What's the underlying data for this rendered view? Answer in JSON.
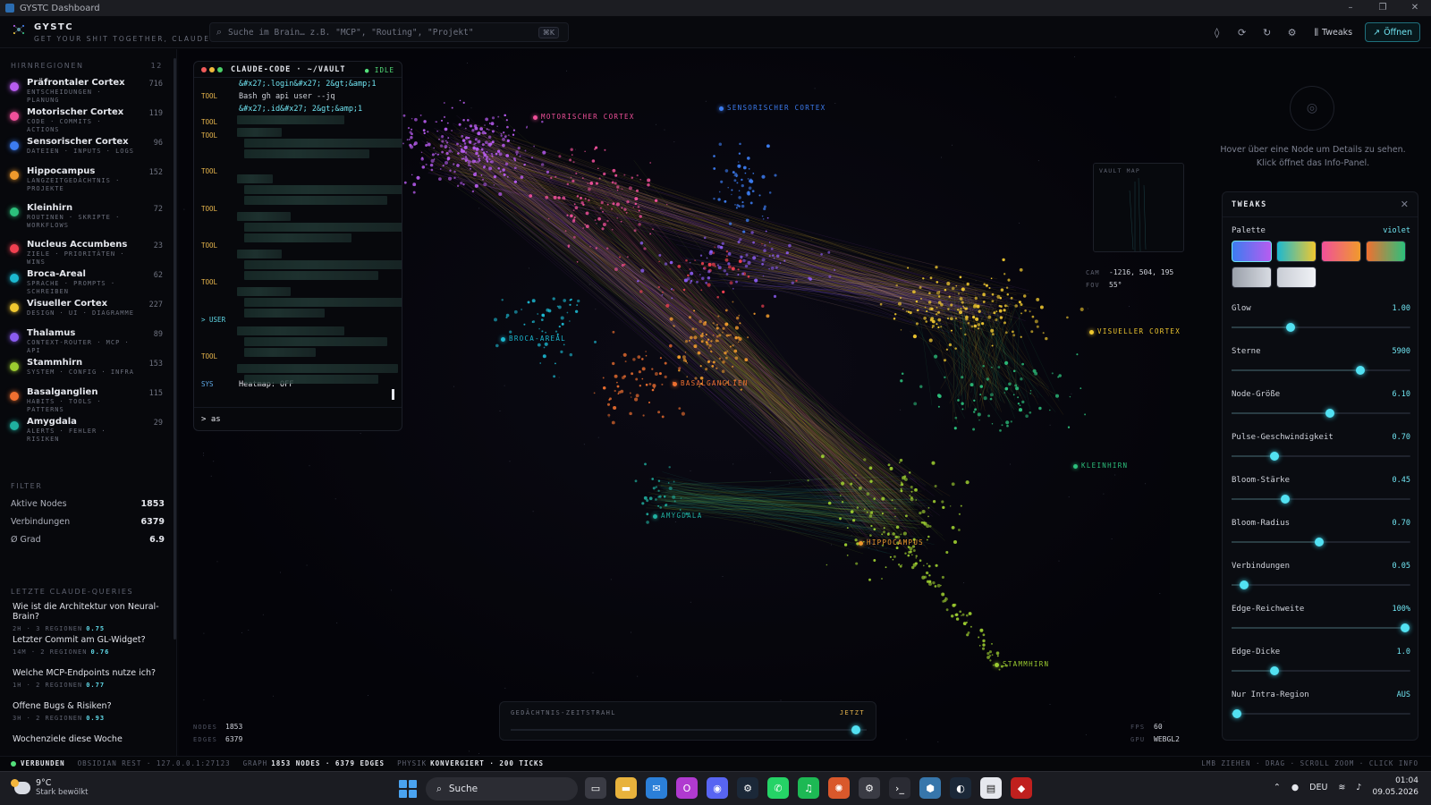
{
  "window": {
    "title": "GYSTC Dashboard",
    "controls": [
      "–",
      "❐",
      "✕"
    ]
  },
  "header": {
    "brand": "GYSTC",
    "tagline": "GET YOUR SHIT TOGETHER, CLAUDE",
    "search_placeholder": "Suche im Brain… z.B. \"MCP\", \"Routing\", \"Projekt\"",
    "search_kbd": "⌘K",
    "tweaks_label": "Tweaks",
    "open_label": "Öffnen"
  },
  "sidebar": {
    "regions_title": "HIRNREGIONEN",
    "regions_count": "12",
    "regions": [
      {
        "name": "Präfrontaler Cortex",
        "sub": "ENTSCHEIDUNGEN · PLANUNG",
        "count": "716",
        "color": "#b85cf0"
      },
      {
        "name": "Motorischer Cortex",
        "sub": "CODE · COMMITS · ACTIONS",
        "count": "119",
        "color": "#f0509a"
      },
      {
        "name": "Sensorischer Cortex",
        "sub": "DATEIEN · INPUTS · LOGS",
        "count": "96",
        "color": "#3c7cf0"
      },
      {
        "name": "Hippocampus",
        "sub": "LANGZEITGEDÄCHTNIS · PROJEKTE",
        "count": "152",
        "color": "#f09a2c"
      },
      {
        "name": "Kleinhirn",
        "sub": "ROUTINEN · SKRIPTE · WORKFLOWS",
        "count": "72",
        "color": "#2cc07c"
      },
      {
        "name": "Nucleus Accumbens",
        "sub": "ZIELE · PRIORITÄTEN · WINS",
        "count": "23",
        "color": "#f04050"
      },
      {
        "name": "Broca-Areal",
        "sub": "SPRACHE · PROMPTS · SCHREIBEN",
        "count": "62",
        "color": "#1cb8d0"
      },
      {
        "name": "Visueller Cortex",
        "sub": "DESIGN · UI · DIAGRAMME",
        "count": "227",
        "color": "#f0c830"
      },
      {
        "name": "Thalamus",
        "sub": "CONTEXT-ROUTER · MCP · API",
        "count": "89",
        "color": "#8a5cf0"
      },
      {
        "name": "Stammhirn",
        "sub": "SYSTEM · CONFIG · INFRA",
        "count": "153",
        "color": "#9ccc30"
      },
      {
        "name": "Basalganglien",
        "sub": "HABITS · TOOLS · PATTERNS",
        "count": "115",
        "color": "#f07030"
      },
      {
        "name": "Amygdala",
        "sub": "ALERTS · FEHLER · RISIKEN",
        "count": "29",
        "color": "#20b0a0"
      }
    ],
    "filter_title": "FILTER",
    "filters": [
      {
        "label": "Aktive Nodes",
        "value": "1853"
      },
      {
        "label": "Verbindungen",
        "value": "6379"
      },
      {
        "label": "Ø Grad",
        "value": "6.9"
      }
    ],
    "queries_title": "LETZTE CLAUDE-QUERIES",
    "queries": [
      {
        "text": "Wie ist die Architektur von Neural-Brain?",
        "meta": "2H · 3 REGIONEN",
        "score": "0.75"
      },
      {
        "text": "Letzter Commit am GL-Widget?",
        "meta": "14M · 2 REGIONEN",
        "score": "0.76"
      },
      {
        "text": "Welche MCP-Endpoints nutze ich?",
        "meta": "1H · 2 REGIONEN",
        "score": "0.77"
      },
      {
        "text": "Offene Bugs & Risiken?",
        "meta": "3H · 2 REGIONEN",
        "score": "0.93"
      },
      {
        "text": "Wochenziele diese Woche",
        "meta": "",
        "score": ""
      }
    ]
  },
  "terminal": {
    "title": "CLAUDE-CODE · ~/VAULT",
    "status": "● IDLE",
    "lines": [
      {
        "tag": "",
        "text": "&#x27;.login&#x27; 2&gt;&amp;1"
      },
      {
        "tag": "TOOL",
        "text": "Bash gh api user --jq"
      },
      {
        "tag": "",
        "text": "&#x27;.id&#x27; 2&gt;&amp;1"
      },
      {
        "tag": "TOOL",
        "text": ""
      },
      {
        "tag": "TOOL",
        "text": ""
      },
      {
        "tag": "TOOL",
        "text": ""
      },
      {
        "tag": "TOOL",
        "text": ""
      },
      {
        "tag": "TOOL",
        "text": ""
      },
      {
        "tag": "TOOL",
        "text": ""
      },
      {
        "tag": "> USER",
        "text": ""
      },
      {
        "tag": "TOOL",
        "text": ""
      },
      {
        "tag": "SYS",
        "text": "Heatmap: OFF"
      }
    ],
    "input": "> as"
  },
  "graph": {
    "labels": [
      {
        "text": "MOTORISCHER CORTEX",
        "color": "#f0509a"
      },
      {
        "text": "SENSORISCHER CORTEX",
        "color": "#3c7cf0"
      },
      {
        "text": "BROCA-AREAL",
        "color": "#1cb8d0"
      },
      {
        "text": "VISUELLER CORTEX",
        "color": "#f0c830"
      },
      {
        "text": "KLEINHIRN",
        "color": "#2cc07c"
      },
      {
        "text": "BASALGANGLIEN",
        "color": "#f07030"
      },
      {
        "text": "AMYGDALA",
        "color": "#20b0a0"
      },
      {
        "text": "HIPPOCAMPUS",
        "color": "#f09a2c"
      },
      {
        "text": "STAMMHIRN",
        "color": "#9ccc30"
      }
    ]
  },
  "vault_map": {
    "label": "VAULT MAP"
  },
  "camera": {
    "cam_label": "CAM",
    "cam_value": "-1216, 504, 195",
    "fov_label": "FOV",
    "fov_value": "55°"
  },
  "hint": {
    "line1": "Hover über eine Node um Details zu sehen.",
    "line2": "Klick öffnet das Info-Panel."
  },
  "tweaks": {
    "title": "TWEAKS",
    "palette_label": "Palette",
    "palette_value": "violet",
    "swatches": [
      [
        "#3c7cf0",
        "#b85cf0"
      ],
      [
        "#1cb8d0",
        "#f0c830"
      ],
      [
        "#f0509a",
        "#f09a2c"
      ],
      [
        "#f07030",
        "#2cc07c"
      ],
      [
        "#9aa0aa",
        "#d8dbe2"
      ],
      [
        "#c8ccd4",
        "#f0f2f6"
      ]
    ],
    "sliders": [
      {
        "name": "Glow",
        "value": "1.00",
        "pos": 0.33
      },
      {
        "name": "Sterne",
        "value": "5900",
        "pos": 0.72
      },
      {
        "name": "Node-Größe",
        "value": "6.10",
        "pos": 0.55
      },
      {
        "name": "Pulse-Geschwindigkeit",
        "value": "0.70",
        "pos": 0.24
      },
      {
        "name": "Bloom-Stärke",
        "value": "0.45",
        "pos": 0.3
      },
      {
        "name": "Bloom-Radius",
        "value": "0.70",
        "pos": 0.49
      },
      {
        "name": "Verbindungen",
        "value": "0.05",
        "pos": 0.07
      },
      {
        "name": "Edge-Reichweite",
        "value": "100%",
        "pos": 0.97
      },
      {
        "name": "Edge-Dicke",
        "value": "1.0",
        "pos": 0.24
      },
      {
        "name": "Nur Intra-Region",
        "value": "AUS",
        "pos": 0.03
      }
    ]
  },
  "stats_left": {
    "nodes_label": "NODES",
    "nodes": "1853",
    "edges_label": "EDGES",
    "edges": "6379"
  },
  "timeline": {
    "label": "GEDÄCHTNIS-ZEITSTRAHL",
    "now": "JETZT",
    "pos": 0.97
  },
  "stats_right": {
    "fps_label": "FPS",
    "fps": "60",
    "gpu_label": "GPU",
    "gpu": "WEBGL2"
  },
  "statusbar": {
    "connected": "VERBUNDEN",
    "rest": "OBSIDIAN REST · 127.0.0.1:27123",
    "graph_label": "GRAPH",
    "graph_value": "1853 NODES · 6379 EDGES",
    "physics_label": "PHYSIK",
    "physics_value": "KONVERGIERT · 200 TICKS",
    "hints": "LMB ZIEHEN · DRAG · SCROLL ZOOM · CLICK INFO"
  },
  "taskbar": {
    "temp": "9°C",
    "condition": "Stark bewölkt",
    "search": "Suche",
    "lang": "DEU",
    "time": "01:04",
    "date": "09.05.2026"
  }
}
